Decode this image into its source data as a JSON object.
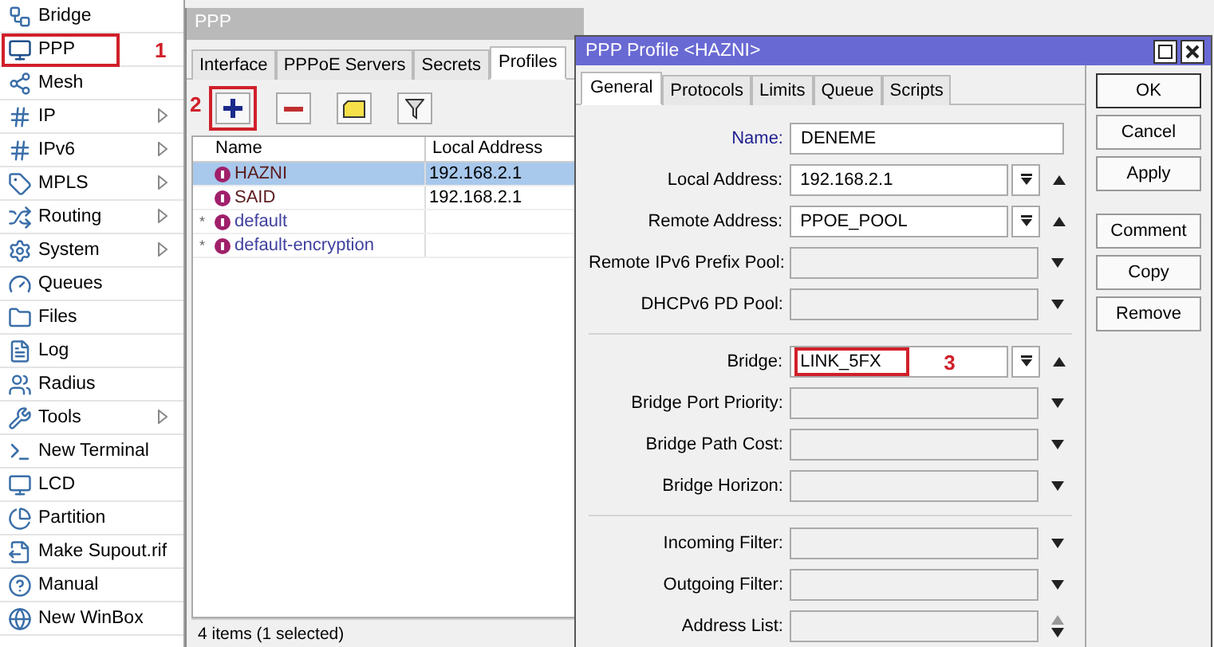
{
  "sidebar": {
    "items": [
      {
        "label": "Bridge",
        "submenu": false,
        "selected": false
      },
      {
        "label": "PPP",
        "submenu": false,
        "selected": true,
        "annotation": "1"
      },
      {
        "label": "Mesh",
        "submenu": false,
        "selected": false
      },
      {
        "label": "IP",
        "submenu": true,
        "selected": false
      },
      {
        "label": "IPv6",
        "submenu": true,
        "selected": false
      },
      {
        "label": "MPLS",
        "submenu": true,
        "selected": false
      },
      {
        "label": "Routing",
        "submenu": true,
        "selected": false
      },
      {
        "label": "System",
        "submenu": true,
        "selected": false
      },
      {
        "label": "Queues",
        "submenu": false,
        "selected": false
      },
      {
        "label": "Files",
        "submenu": false,
        "selected": false
      },
      {
        "label": "Log",
        "submenu": false,
        "selected": false
      },
      {
        "label": "Radius",
        "submenu": false,
        "selected": false
      },
      {
        "label": "Tools",
        "submenu": true,
        "selected": false
      },
      {
        "label": "New Terminal",
        "submenu": false,
        "selected": false
      },
      {
        "label": "LCD",
        "submenu": false,
        "selected": false
      },
      {
        "label": "Partition",
        "submenu": false,
        "selected": false
      },
      {
        "label": "Make Supout.rif",
        "submenu": false,
        "selected": false
      },
      {
        "label": "Manual",
        "submenu": false,
        "selected": false
      },
      {
        "label": "New WinBox",
        "submenu": false,
        "selected": false
      }
    ]
  },
  "ppp_window": {
    "title": "PPP",
    "tabs": [
      {
        "label": "Interface",
        "selected": false
      },
      {
        "label": "PPPoE Servers",
        "selected": false
      },
      {
        "label": "Secrets",
        "selected": false
      },
      {
        "label": "Profiles",
        "selected": true
      }
    ],
    "toolbar": [
      {
        "kind": "add",
        "annotation": "2"
      },
      {
        "kind": "remove"
      },
      {
        "kind": "comment"
      },
      {
        "kind": "filter"
      }
    ],
    "table": {
      "columns": [
        "Name",
        "Local Address"
      ],
      "rows": [
        {
          "flag": "",
          "name": "HAZNI",
          "local_address": "192.168.2.1",
          "selected": true
        },
        {
          "flag": "",
          "name": "SAID",
          "local_address": "192.168.2.1",
          "selected": false
        },
        {
          "flag": "*",
          "name": "default",
          "local_address": "",
          "selected": false
        },
        {
          "flag": "*",
          "name": "default-encryption",
          "local_address": "",
          "selected": false
        }
      ]
    },
    "status_bar": "4 items (1 selected)"
  },
  "profile_dialog": {
    "title": "PPP Profile <HAZNI>",
    "tabs": [
      {
        "label": "General",
        "selected": true
      },
      {
        "label": "Protocols",
        "selected": false
      },
      {
        "label": "Limits",
        "selected": false
      },
      {
        "label": "Queue",
        "selected": false
      },
      {
        "label": "Scripts",
        "selected": false
      }
    ],
    "sections": [
      [
        {
          "label": "Name:",
          "kind": "text",
          "value": "DENEME"
        },
        {
          "label": "Local Address:",
          "kind": "select",
          "value": "192.168.2.1"
        },
        {
          "label": "Remote Address:",
          "kind": "select",
          "value": "PPOE_POOL"
        },
        {
          "label": "Remote IPv6 Prefix Pool:",
          "kind": "unset"
        },
        {
          "label": "DHCPv6 PD Pool:",
          "kind": "unset"
        }
      ],
      [
        {
          "label": "Bridge:",
          "kind": "select",
          "value": "LINK_5FX",
          "annotation": "3"
        },
        {
          "label": "Bridge Port Priority:",
          "kind": "unset"
        },
        {
          "label": "Bridge Path Cost:",
          "kind": "unset"
        },
        {
          "label": "Bridge Horizon:",
          "kind": "unset"
        }
      ],
      [
        {
          "label": "Incoming Filter:",
          "kind": "unset"
        },
        {
          "label": "Outgoing Filter:",
          "kind": "unset"
        },
        {
          "label": "Address List:",
          "kind": "unset_list"
        }
      ]
    ],
    "buttons": [
      "OK",
      "Cancel",
      "Apply",
      "Comment",
      "Copy",
      "Remove"
    ]
  }
}
